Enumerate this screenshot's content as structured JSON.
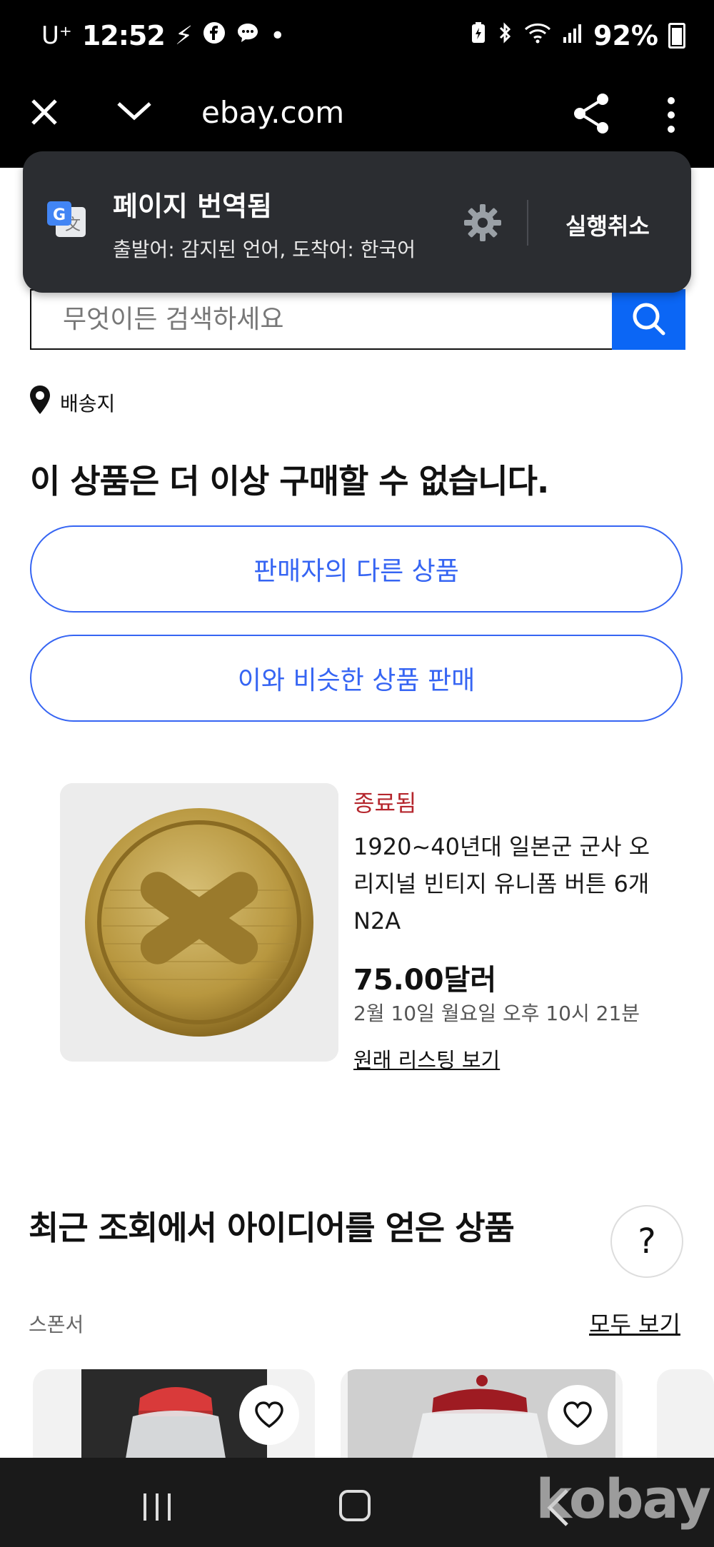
{
  "status_bar": {
    "carrier": "U⁺",
    "time": "12:52",
    "battery_percent": "92%"
  },
  "browser": {
    "url": "ebay.com"
  },
  "translation_popup": {
    "title": "페이지 번역됨",
    "subtitle": "출발어: 감지된 언어, 도착어: 한국어",
    "undo_label": "실행취소"
  },
  "search": {
    "placeholder": "무엇이든 검색하세요"
  },
  "ship_to_label": "배송지",
  "main": {
    "heading": "이 상품은 더 이상 구매할 수 없습니다.",
    "seller_items_button": "판매자의 다른 상품",
    "sell_similar_button": "이와 비슷한 상품 판매"
  },
  "item": {
    "status": "종료됨",
    "title": "1920~40년대 일본군 군사 오리지널 빈티지 유니폼 버튼 6개 N2A",
    "price": "75.00달러",
    "end_date": "2월 10일 월요일 오후 10시 21분",
    "view_original_link": "원래 리스팅 보기"
  },
  "recommendations": {
    "title": "최근 조회에서 아이디어를 얻은 상품",
    "sponsor_label": "스폰서",
    "see_all": "모두 보기",
    "help_label": "?"
  },
  "watermark": "kobay",
  "colors": {
    "accent": "#3665f3",
    "search_button": "#0b66f5",
    "ended_status": "#b5262d",
    "popup_bg": "#2b2d31"
  }
}
